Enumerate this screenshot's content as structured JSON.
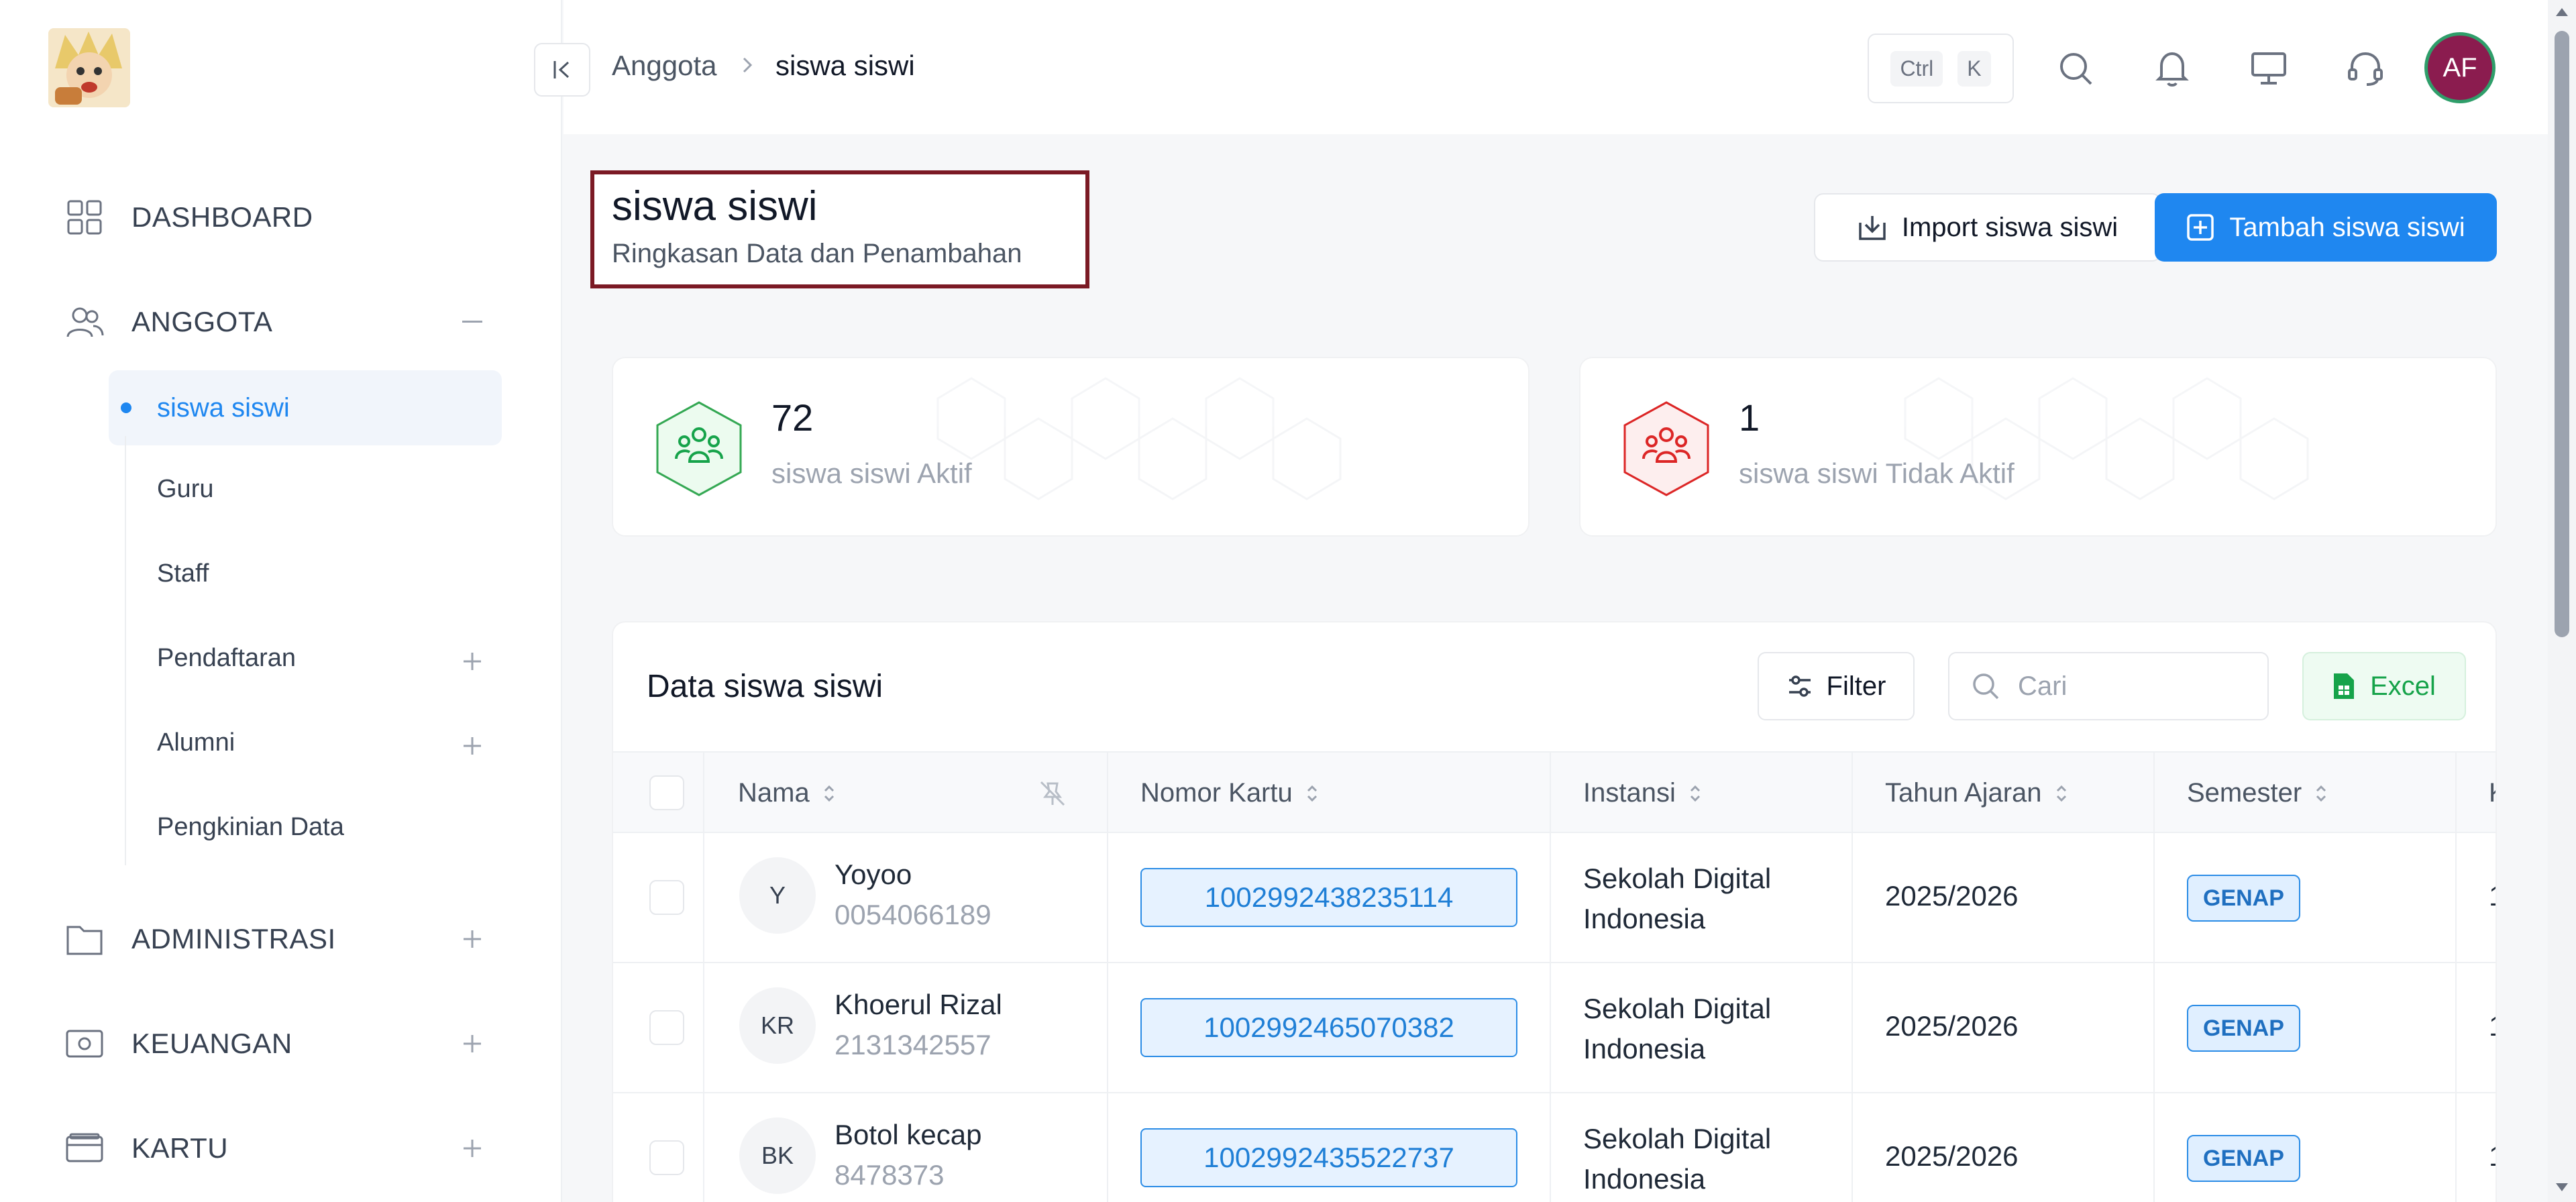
{
  "sidebar": {
    "nav": {
      "dashboard": "DASHBOARD",
      "anggota": "ANGGOTA",
      "administrasi": "ADMINISTRASI",
      "keuangan": "KEUANGAN",
      "kartu": "KARTU"
    },
    "sub_items": [
      "siswa siswi",
      "Guru",
      "Staff",
      "Pendaftaran",
      "Alumni",
      "Pengkinian Data"
    ],
    "active_item": "siswa siswi"
  },
  "topbar": {
    "breadcrumb": [
      "Anggota",
      "siswa siswi"
    ],
    "shortcut_keys": [
      "Ctrl",
      "K"
    ],
    "avatar_initials": "AF",
    "icons": [
      "search-icon",
      "bell-icon",
      "monitor-icon",
      "headset-icon"
    ]
  },
  "header": {
    "title": "siswa siswi",
    "subtitle": "Ringkasan Data dan Penambahan",
    "import_label": "Import siswa siswi",
    "add_label": "Tambah siswa siswi"
  },
  "stats": {
    "active": {
      "value": "72",
      "label": "siswa siswi Aktif"
    },
    "inactive": {
      "value": "1",
      "label": "siswa siswi Tidak Aktif"
    }
  },
  "table": {
    "title": "Data siswa siswi",
    "filter_label": "Filter",
    "search_placeholder": "Cari",
    "excel_label": "Excel",
    "columns": [
      "Nama",
      "Nomor Kartu",
      "Instansi",
      "Tahun Ajaran",
      "Semester",
      "K"
    ],
    "rows": [
      {
        "initials": "Y",
        "name": "Yoyoo",
        "id": "0054066189",
        "card": "1002992438235114",
        "inst1": "Sekolah Digital",
        "inst2": "Indonesia",
        "year": "2025/2026",
        "semester": "GENAP",
        "extra": "1"
      },
      {
        "initials": "KR",
        "name": "Khoerul Rizal",
        "id": "2131342557",
        "card": "1002992465070382",
        "inst1": "Sekolah Digital",
        "inst2": "Indonesia",
        "year": "2025/2026",
        "semester": "GENAP",
        "extra": "1"
      },
      {
        "initials": "BK",
        "name": "Botol kecap",
        "id": "8478373",
        "card": "1002992435522737",
        "inst1": "Sekolah Digital",
        "inst2": "Indonesia",
        "year": "2025/2026",
        "semester": "GENAP",
        "extra": "1"
      }
    ]
  },
  "colors": {
    "primary": "#1f87f0",
    "title_outline": "#7b1a24",
    "active_green": "#16a34a",
    "inactive_red": "#dc2626",
    "avatar_bg": "#8b1c4f"
  }
}
